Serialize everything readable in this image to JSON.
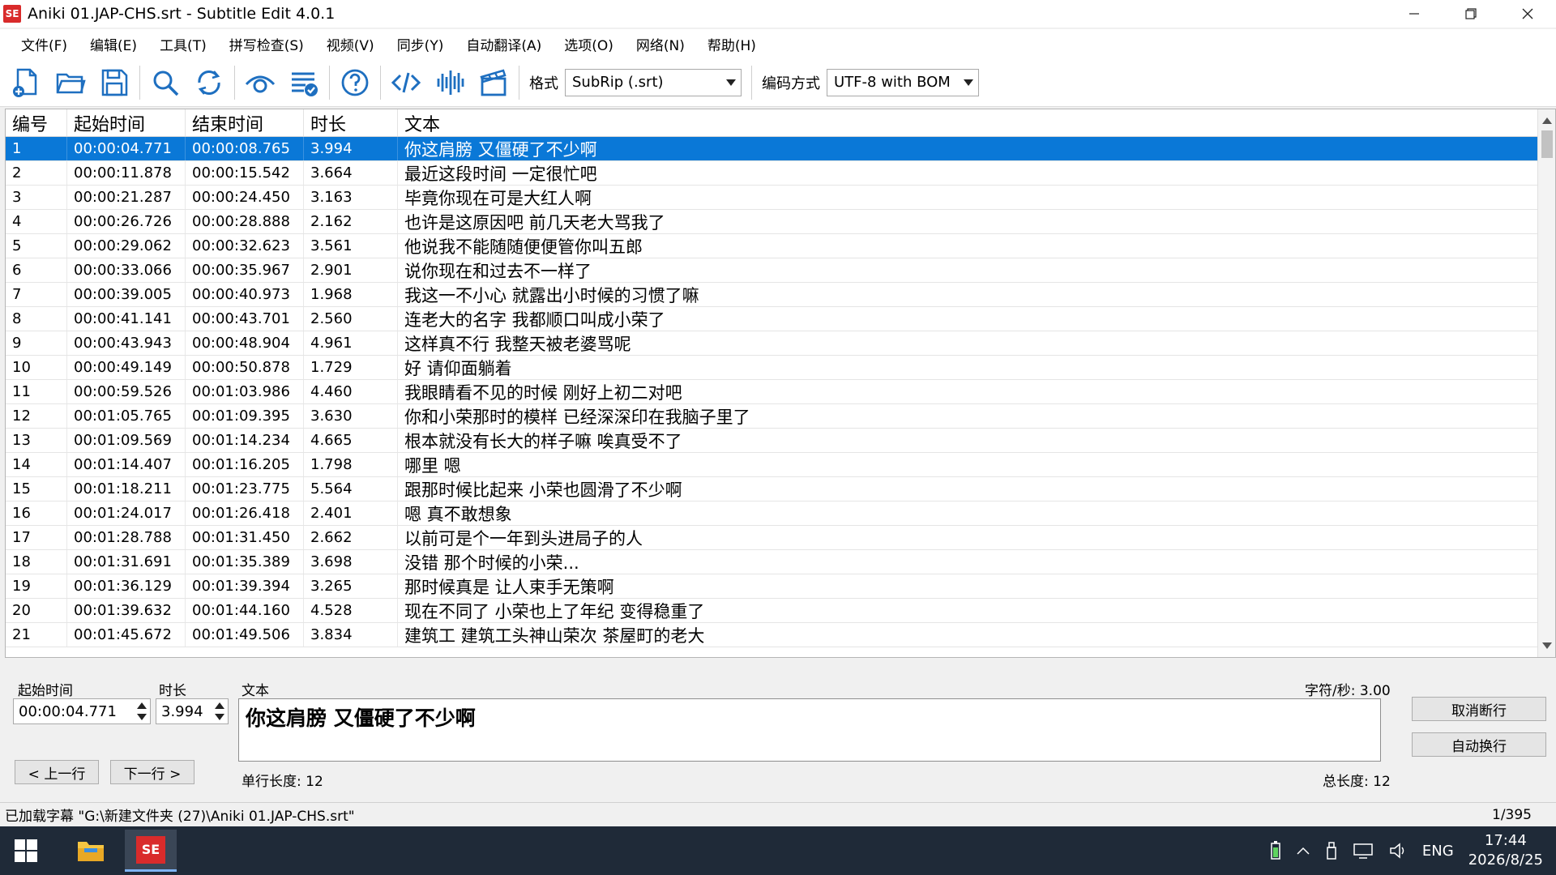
{
  "window": {
    "title": "Aniki 01.JAP-CHS.srt - Subtitle Edit 4.0.1",
    "app_icon_text": "SE"
  },
  "menu": [
    "文件(F)",
    "编辑(E)",
    "工具(T)",
    "拼写检查(S)",
    "视频(V)",
    "同步(Y)",
    "自动翻译(A)",
    "选项(O)",
    "网络(N)",
    "帮助(H)"
  ],
  "toolbar": {
    "buttons": [
      "new-file-icon",
      "open-folder-icon",
      "save-icon",
      "find-icon",
      "replace-icon",
      "visual-sync-icon",
      "spell-check-icon",
      "help-icon",
      "source-view-icon",
      "waveform-icon",
      "video-icon"
    ],
    "format_label": "格式",
    "format_value": "SubRip (.srt)",
    "encoding_label": "编码方式",
    "encoding_value": "UTF-8 with BOM"
  },
  "grid": {
    "headers": [
      "编号",
      "起始时间",
      "结束时间",
      "时长",
      "文本"
    ],
    "selected_index": 0,
    "rows": [
      [
        "1",
        "00:00:04.771",
        "00:00:08.765",
        "3.994",
        "你这肩膀 又僵硬了不少啊"
      ],
      [
        "2",
        "00:00:11.878",
        "00:00:15.542",
        "3.664",
        "最近这段时间 一定很忙吧"
      ],
      [
        "3",
        "00:00:21.287",
        "00:00:24.450",
        "3.163",
        "毕竟你现在可是大红人啊"
      ],
      [
        "4",
        "00:00:26.726",
        "00:00:28.888",
        "2.162",
        "也许是这原因吧 前几天老大骂我了"
      ],
      [
        "5",
        "00:00:29.062",
        "00:00:32.623",
        "3.561",
        "他说我不能随随便便管你叫五郎"
      ],
      [
        "6",
        "00:00:33.066",
        "00:00:35.967",
        "2.901",
        "说你现在和过去不一样了"
      ],
      [
        "7",
        "00:00:39.005",
        "00:00:40.973",
        "1.968",
        "我这一不小心 就露出小时候的习惯了嘛"
      ],
      [
        "8",
        "00:00:41.141",
        "00:00:43.701",
        "2.560",
        "连老大的名字 我都顺口叫成小荣了"
      ],
      [
        "9",
        "00:00:43.943",
        "00:00:48.904",
        "4.961",
        "这样真不行 我整天被老婆骂呢"
      ],
      [
        "10",
        "00:00:49.149",
        "00:00:50.878",
        "1.729",
        "好 请仰面躺着"
      ],
      [
        "11",
        "00:00:59.526",
        "00:01:03.986",
        "4.460",
        "我眼睛看不见的时候 刚好上初二对吧"
      ],
      [
        "12",
        "00:01:05.765",
        "00:01:09.395",
        "3.630",
        "你和小荣那时的模样 已经深深印在我脑子里了"
      ],
      [
        "13",
        "00:01:09.569",
        "00:01:14.234",
        "4.665",
        "根本就没有长大的样子嘛 唉真受不了"
      ],
      [
        "14",
        "00:01:14.407",
        "00:01:16.205",
        "1.798",
        "哪里 嗯"
      ],
      [
        "15",
        "00:01:18.211",
        "00:01:23.775",
        "5.564",
        "跟那时候比起来 小荣也圆滑了不少啊"
      ],
      [
        "16",
        "00:01:24.017",
        "00:01:26.418",
        "2.401",
        "嗯 真不敢想象"
      ],
      [
        "17",
        "00:01:28.788",
        "00:01:31.450",
        "2.662",
        "以前可是个一年到头进局子的人"
      ],
      [
        "18",
        "00:01:31.691",
        "00:01:35.389",
        "3.698",
        "没错 那个时候的小荣..."
      ],
      [
        "19",
        "00:01:36.129",
        "00:01:39.394",
        "3.265",
        "那时候真是 让人束手无策啊"
      ],
      [
        "20",
        "00:01:39.632",
        "00:01:44.160",
        "4.528",
        "现在不同了 小荣也上了年纪 变得稳重了"
      ],
      [
        "21",
        "00:01:45.672",
        "00:01:49.506",
        "3.834",
        "建筑工 建筑工头神山荣次 茶屋町的老大"
      ]
    ]
  },
  "edit": {
    "start_label": "起始时间",
    "start_value": "00:00:04.771",
    "duration_label": "时长",
    "duration_value": "3.994",
    "text_label": "文本",
    "chars_per_sec": "字符/秒: 3.00",
    "text_value": "你这肩膀 又僵硬了不少啊",
    "prev_button": "< 上一行",
    "next_button": "下一行 >",
    "single_line_length": "单行长度: 12",
    "total_length": "总长度: 12",
    "unbreak_button": "取消断行",
    "auto_break_button": "自动换行"
  },
  "status": {
    "message": "已加载字幕 \"G:\\新建文件夹 (27)\\Aniki 01.JAP-CHS.srt\"",
    "position": "1/395"
  },
  "taskbar": {
    "lang": "ENG",
    "time": "17:44",
    "date": "2026/8/25"
  }
}
